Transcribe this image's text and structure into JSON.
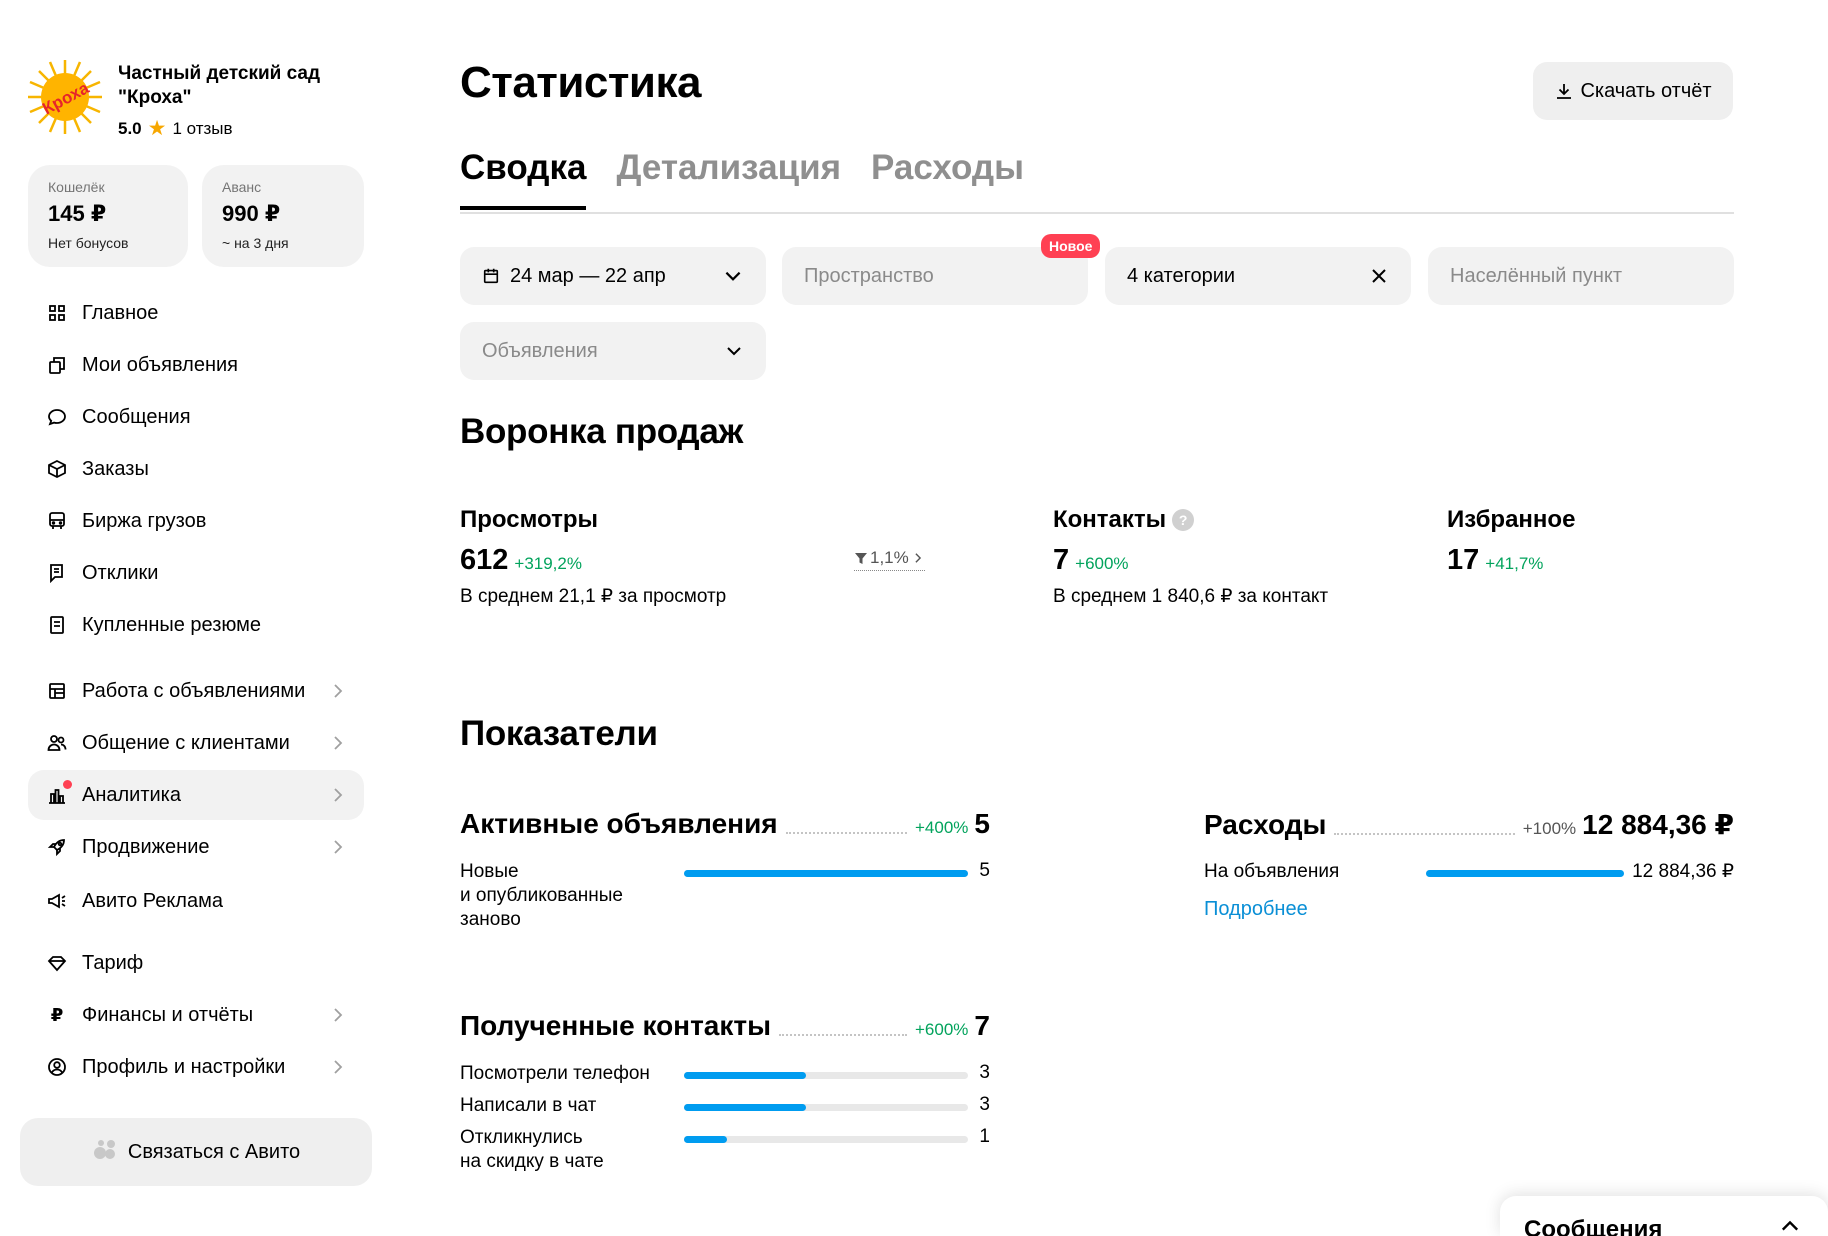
{
  "shop": {
    "name": "Частный детский сад \"Кроха\"",
    "logo_text": "Кроха",
    "rating": "5.0",
    "reviews": "1 отзыв"
  },
  "wallets": [
    {
      "label": "Кошелёк",
      "value": "145 ₽",
      "sub": "Нет бонусов"
    },
    {
      "label": "Аванс",
      "value": "990 ₽",
      "sub": "~ на 3 дня"
    }
  ],
  "nav": [
    {
      "label": "Главное",
      "icon": "grid-icon"
    },
    {
      "label": "Мои объявления",
      "icon": "copy-icon"
    },
    {
      "label": "Сообщения",
      "icon": "chat-icon"
    },
    {
      "label": "Заказы",
      "icon": "box-icon"
    },
    {
      "label": "Биржа грузов",
      "icon": "truck-icon"
    },
    {
      "label": "Отклики",
      "icon": "responses-icon"
    },
    {
      "label": "Купленные резюме",
      "icon": "resume-icon"
    },
    {
      "label": "Работа с объявлениями",
      "icon": "store-icon"
    },
    {
      "label": "Общение с клиентами",
      "icon": "people-icon"
    },
    {
      "label": "Аналитика",
      "icon": "chart-icon"
    },
    {
      "label": "Продвижение",
      "icon": "rocket-icon"
    },
    {
      "label": "Авито Реклама",
      "icon": "megaphone-icon"
    },
    {
      "label": "Тариф",
      "icon": "diamond-icon"
    },
    {
      "label": "Финансы и отчёты",
      "icon": "ruble-icon"
    },
    {
      "label": "Профиль и настройки",
      "icon": "profile-icon"
    }
  ],
  "contact_button": "Связаться с Авито",
  "page": {
    "title": "Статистика",
    "download_label": "Скачать отчёт",
    "tabs": [
      "Сводка",
      "Детализация",
      "Расходы"
    ]
  },
  "filters": {
    "date": "24 мар — 22 апр",
    "space_placeholder": "Пространство",
    "new_badge": "Новое",
    "categories": "4 категории",
    "city_placeholder": "Населённый пункт",
    "ads_placeholder": "Объявления"
  },
  "funnel": {
    "title": "Воронка продаж",
    "views": {
      "name": "Просмотры",
      "value": "612",
      "delta": "+319,2%",
      "avg": "В среднем 21,1 ₽ за просмотр"
    },
    "conversion": "1,1%",
    "contacts": {
      "name": "Контакты",
      "value": "7",
      "delta": "+600%",
      "avg": "В среднем 1 840,6 ₽ за контакт"
    },
    "favorites": {
      "name": "Избранное",
      "value": "17",
      "delta": "+41,7%"
    }
  },
  "indicators": {
    "title": "Показатели",
    "active_ads": {
      "title": "Активные объявления",
      "delta": "+400%",
      "value": "5",
      "rows": [
        {
          "label": "Новые\nи опубликованные\nзаново",
          "value": "5",
          "fraction": 1.0
        }
      ]
    },
    "expenses": {
      "title": "Расходы",
      "delta": "+100%",
      "value": "12 884,36 ₽",
      "rows": [
        {
          "label": "На объявления",
          "value": "12 884,36 ₽",
          "fraction": 1.0
        }
      ],
      "link": "Подробнее"
    },
    "contacts": {
      "title": "Полученные контакты",
      "delta": "+600%",
      "value": "7",
      "rows": [
        {
          "label": "Посмотрели телефон",
          "value": "3",
          "fraction": 0.43
        },
        {
          "label": "Написали в чат",
          "value": "3",
          "fraction": 0.43
        },
        {
          "label": "Откликнулись\nна скидку в чате",
          "value": "1",
          "fraction": 0.15
        }
      ]
    }
  },
  "messages_bar": "Сообщения"
}
